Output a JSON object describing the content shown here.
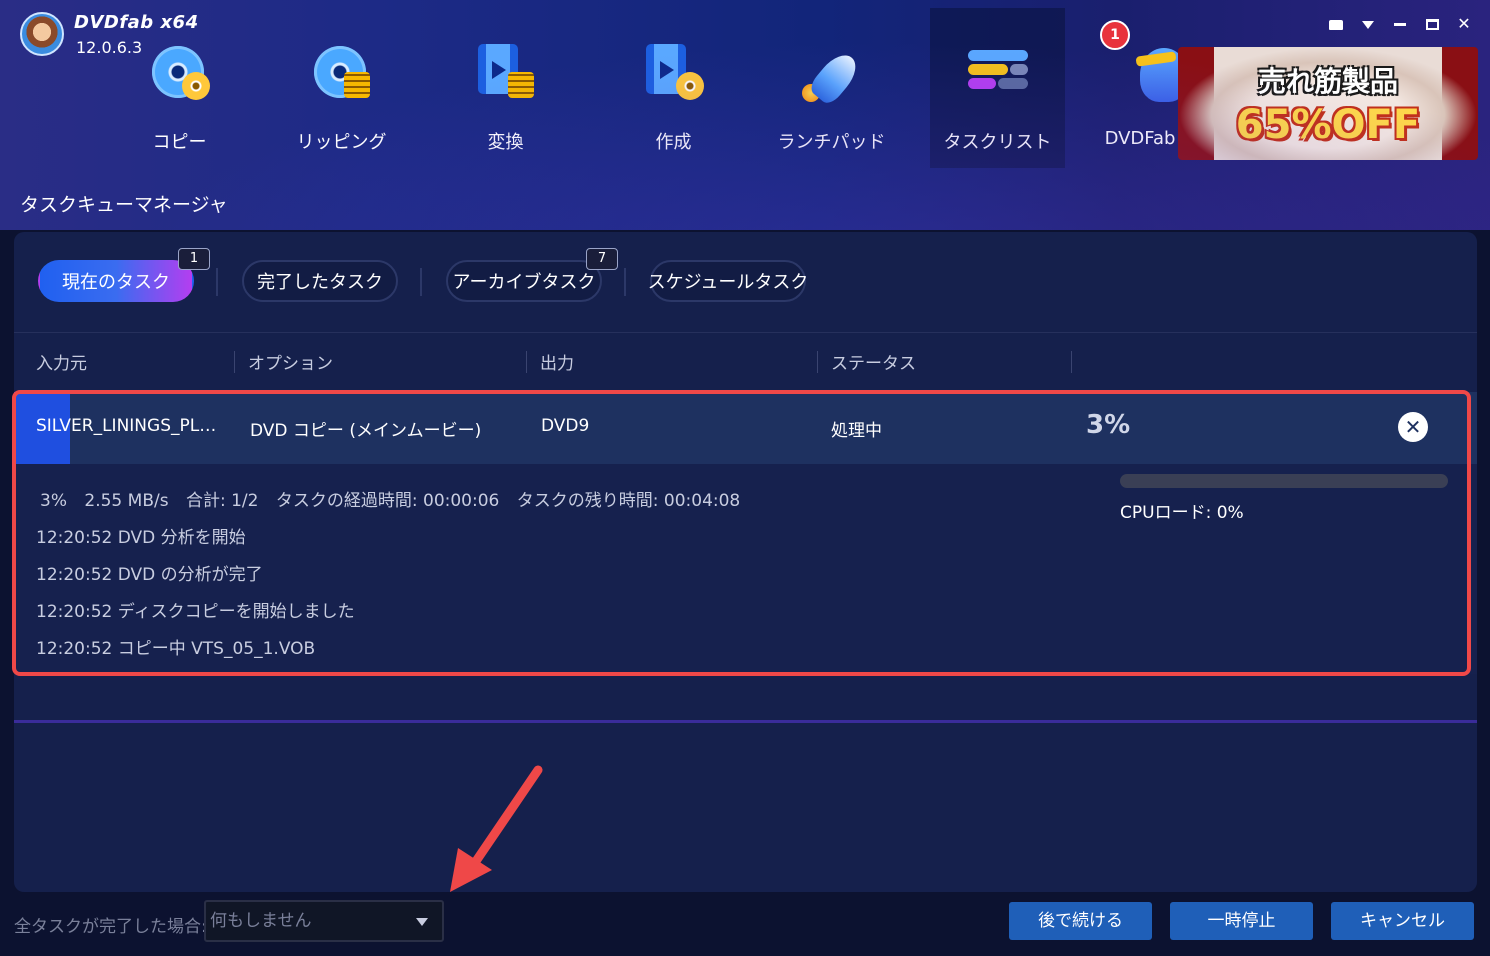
{
  "app": {
    "name": "DVDfab x64",
    "version": "12.0.6.3"
  },
  "nav": {
    "items": [
      {
        "label": "コピー",
        "icon": "disc-copy-icon"
      },
      {
        "label": "リッピング",
        "icon": "disc-ripping-icon"
      },
      {
        "label": "変換",
        "icon": "film-convert-icon"
      },
      {
        "label": "作成",
        "icon": "film-create-icon"
      },
      {
        "label": "ランチパッド",
        "icon": "rocket-icon"
      },
      {
        "label": "タスクリスト",
        "icon": "task-list-icon"
      },
      {
        "label": "DVDFab",
        "icon": "helmet-icon"
      }
    ],
    "active_index": 5,
    "notification_count": "1"
  },
  "promo": {
    "title": "売れ筋製品",
    "discount": "65%OFF"
  },
  "page_title": "タスクキューマネージャ",
  "tabs": [
    {
      "label": "現在のタスク",
      "count": "1"
    },
    {
      "label": "完了したタスク",
      "count": ""
    },
    {
      "label": "アーカイブタスク",
      "count": "7"
    },
    {
      "label": "スケジュールタスク",
      "count": ""
    }
  ],
  "columns": {
    "source": "入力元",
    "option": "オプション",
    "output": "出力",
    "status": "ステータス"
  },
  "task": {
    "source": "SILVER_LININGS_PL…",
    "option": "DVD コピー (メインムービー)",
    "output": "DVD9",
    "status": "処理中",
    "percent": "3%",
    "progress": 0.03
  },
  "details": {
    "percent": "3%",
    "speed": "2.55 MB/s",
    "total": "合計: 1/2",
    "elapsed": "タスクの経過時間: 00:00:06",
    "remaining": "タスクの残り時間: 00:04:08",
    "log": [
      "12:20:52  DVD 分析を開始",
      "12:20:52  DVD の分析が完了",
      "12:20:52  ディスクコピーを開始しました",
      "12:20:52  コピー中 VTS_05_1.VOB"
    ],
    "cpu_label": "CPUロード: 0%",
    "cpu_load": 0
  },
  "bottom": {
    "on_complete_label": "全タスクが完了した場合:",
    "on_complete_value": "何もしません",
    "resume_later": "後で続ける",
    "pause": "一時停止",
    "cancel": "キャンセル"
  },
  "colors": {
    "accent": "#1f5fb8",
    "highlight": "#ef4848",
    "tab_gradient_start": "#2060f0",
    "tab_gradient_end": "#b43ef0"
  }
}
